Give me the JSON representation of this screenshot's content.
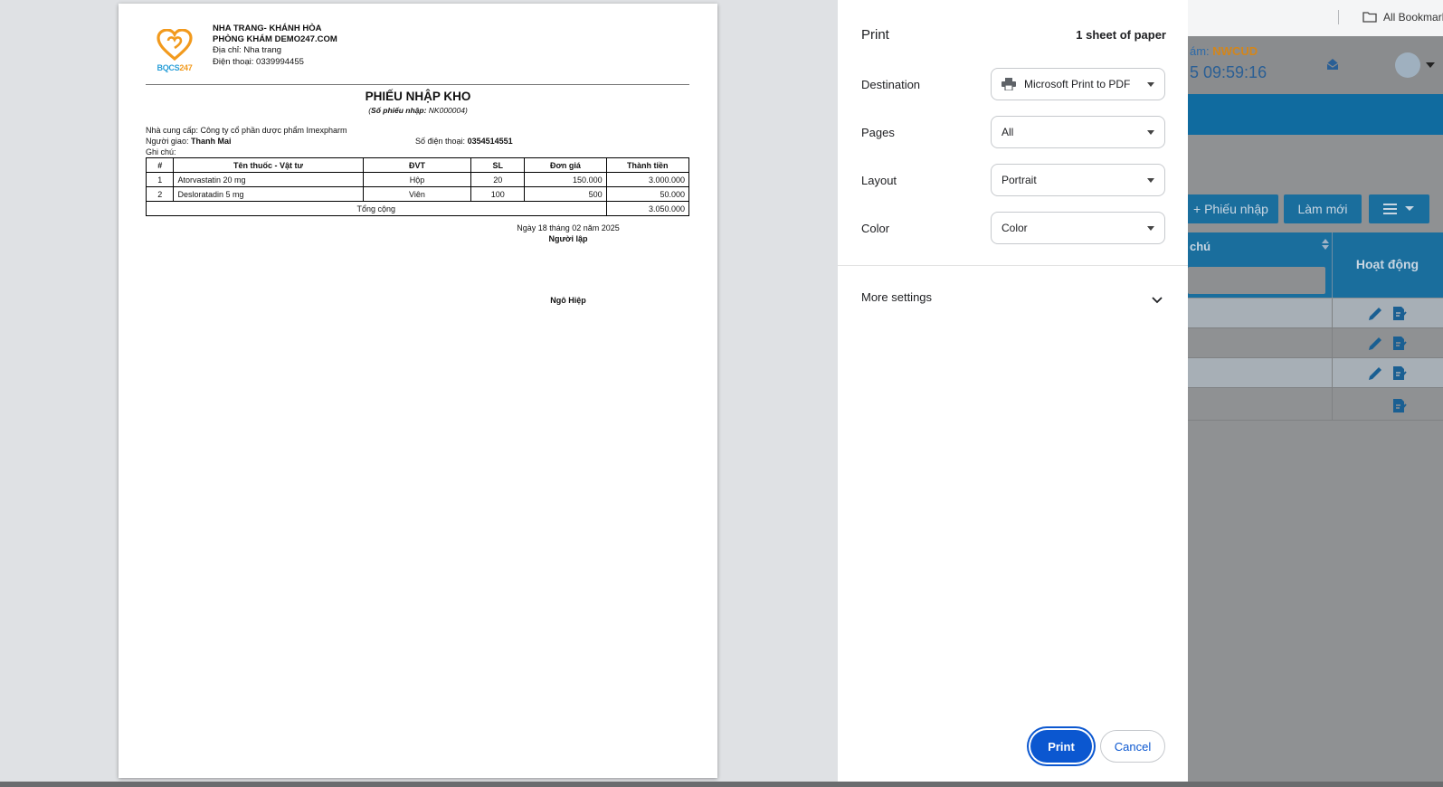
{
  "document": {
    "logo_text_a": "BQCS",
    "logo_text_b": "247",
    "clinic_line1": "NHA TRANG- KHÁNH HÒA",
    "clinic_line2": "PHÒNG KHÁM DEMO247.COM",
    "address": "Địa chỉ: Nha trang",
    "phone": "Điện thoại: 0339994455",
    "title": "PHIẾU NHẬP KHO",
    "receipt_no_label": "Số phiếu nhập:",
    "receipt_no": "NK000004",
    "supplier": "Nhà cung cấp: Công ty cổ phần dược phẩm Imexpharm",
    "deliverer_label": "Người giao:",
    "deliverer": "Thanh Mai",
    "phone_label": "Số điện thoại:",
    "deliverer_phone": "0354514551",
    "note_label": "Ghi chú:",
    "table": {
      "headers": [
        "#",
        "Tên thuốc - Vật tư",
        "ĐVT",
        "SL",
        "Đơn giá",
        "Thành tiền"
      ],
      "rows": [
        {
          "no": "1",
          "name": "Atorvastatin 20 mg",
          "unit": "Hộp",
          "qty": "20",
          "price": "150.000",
          "amount": "3.000.000"
        },
        {
          "no": "2",
          "name": "Desloratadin 5 mg",
          "unit": "Viên",
          "qty": "100",
          "price": "500",
          "amount": "50.000"
        }
      ],
      "total_label": "Tổng cộng",
      "total": "3.050.000"
    },
    "date_line": "Ngày 18 tháng 02 năm 2025",
    "creator_label": "Người lập",
    "creator_name": "Ngô Hiệp"
  },
  "print_panel": {
    "title": "Print",
    "sheets": "1 sheet of paper",
    "destination_label": "Destination",
    "destination_value": "Microsoft Print to PDF",
    "pages_label": "Pages",
    "pages_value": "All",
    "layout_label": "Layout",
    "layout_value": "Portrait",
    "color_label": "Color",
    "color_value": "Color",
    "more_settings": "More settings",
    "print_button": "Print",
    "cancel_button": "Cancel",
    "accent_color": "#0b57d0"
  },
  "background_app": {
    "bookmarks_label": "All Bookmark",
    "clinic_code_label": "ám:",
    "clinic_code": "NWCUD",
    "clock": "5 09:59:16",
    "btn_phieu_nhap": "+ Phiếu nhập",
    "btn_lam_moi": "Làm mới",
    "col_chu": "chú",
    "col_hoat_dong": "Hoạt động"
  }
}
